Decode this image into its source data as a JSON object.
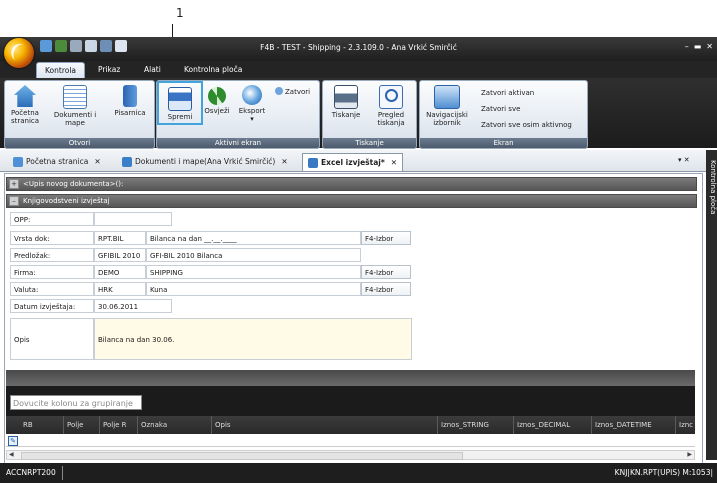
{
  "callout": {
    "number": "1"
  },
  "window": {
    "title": "F4B - TEST - Shipping - 2.3.109.0 - Ana  Vrkić Smirčić",
    "controls": [
      "–",
      "▬",
      "✕"
    ]
  },
  "menu_tabs": [
    "Kontrola",
    "Prikaz",
    "Alati",
    "Kontrolna ploča"
  ],
  "ribbon": {
    "groups": {
      "otvori": "Otvori",
      "aktivni": "Aktivni ekran",
      "tiskanje": "Tiskanje",
      "ekran": "Ekran"
    },
    "pocetna": "Početna stranica",
    "dokumenti": "Dokumenti i mape",
    "pisarnica": "Pisarnica",
    "spremi": "Spremi",
    "osvjezi": "Osvježi",
    "eksport": "Eksport",
    "eksport_arrow": "▾",
    "zatvori": "Zatvori",
    "tiskanje": "Tiskanje",
    "pregled": "Pregled tiskanja",
    "navigacijski": "Navigacijski izbornik",
    "zatvori_aktivan": "Zatvori aktivan",
    "zatvori_sve": "Zatvori sve",
    "zatvori_sve_osim": "Zatvori sve osim aktivnog"
  },
  "doc_tabs": [
    {
      "label": "Početna stranica",
      "close": "✕"
    },
    {
      "label": "Dokumenti i mape(Ana Vrkić Smirčić)",
      "close": "✕"
    },
    {
      "label": "Excel izvještaj*",
      "close": "✕"
    }
  ],
  "doc_tabs_controls": "▾ ✕",
  "side_panel": "Kontrolna ploča",
  "sections": {
    "new_doc": "<Upis novog dokumenta>():",
    "report": "Knjigovodstveni izvještaj",
    "new_doc_sign": "+",
    "report_sign": "–"
  },
  "form": {
    "opp_label": "OPP:",
    "vrsta_label": "Vrsta dok:",
    "vrsta_value": "RPT.BIL",
    "vrsta_desc": "Bilanca na dan __.__.____",
    "vrsta_btn": "F4-Izbor",
    "predlozak_label": "Predložak:",
    "predlozak_value": "GFIBIL 2010",
    "predlozak_desc": "GFI-BIL 2010 Bilanca",
    "firma_label": "Firma:",
    "firma_value": "DEMO",
    "firma_desc": "SHIPPING",
    "firma_btn": "F4-Izbor",
    "valuta_label": "Valuta:",
    "valuta_value": "HRK",
    "valuta_desc": "Kuna",
    "valuta_btn": "F4-Izbor",
    "datum_label": "Datum izvještaja:",
    "datum_value": "30.06.2011",
    "opis_label": "Opis",
    "opis_value": "Bilanca na dan 30.06."
  },
  "grid": {
    "group_placeholder": "Dovucite kolonu za grupiranje",
    "columns": [
      "RB",
      "Polje",
      "Polje R",
      "Oznaka",
      "Opis",
      "Iznos_STRING",
      "Iznos_DECIMAL",
      "Iznos_DATETIME",
      "Iznc"
    ]
  },
  "status": {
    "left": "ACCNRPT200",
    "right": "KNJ|KN.RPT(UPIS) M:1053|"
  }
}
